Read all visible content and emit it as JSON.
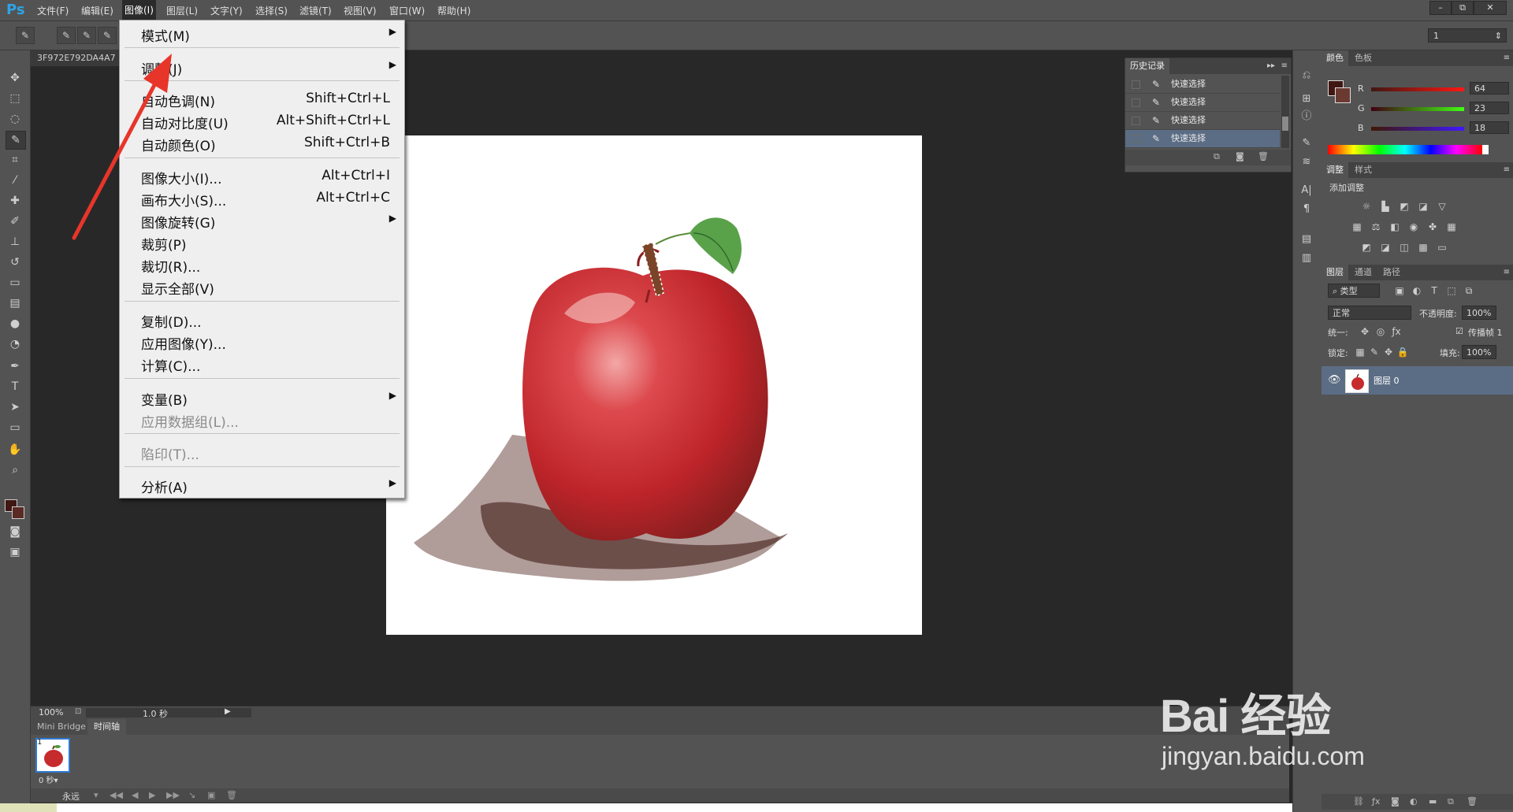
{
  "app": {
    "logo": "Ps"
  },
  "menubar": {
    "items": [
      "文件(F)",
      "编辑(E)",
      "图像(I)",
      "图层(L)",
      "文字(Y)",
      "选择(S)",
      "滤镜(T)",
      "视图(V)",
      "窗口(W)",
      "帮助(H)"
    ],
    "active": "图像(I)"
  },
  "window_buttons": [
    "–",
    "⧉",
    "✕"
  ],
  "options": {
    "select_value": "1"
  },
  "document": {
    "tab_title": "3F972E792DA4A7",
    "zoom": "100%",
    "frame_time": "1.0 秒"
  },
  "image_menu": {
    "items": [
      {
        "label": "模式(M)",
        "shortcut": "",
        "submenu": true,
        "disabled": false
      },
      {
        "label": "调整(J)",
        "shortcut": "",
        "submenu": true,
        "disabled": false
      },
      {
        "label": "自动色调(N)",
        "shortcut": "Shift+Ctrl+L",
        "submenu": false,
        "disabled": false
      },
      {
        "label": "自动对比度(U)",
        "shortcut": "Alt+Shift+Ctrl+L",
        "submenu": false,
        "disabled": false
      },
      {
        "label": "自动颜色(O)",
        "shortcut": "Shift+Ctrl+B",
        "submenu": false,
        "disabled": false
      },
      {
        "label": "图像大小(I)...",
        "shortcut": "Alt+Ctrl+I",
        "submenu": false,
        "disabled": false
      },
      {
        "label": "画布大小(S)...",
        "shortcut": "Alt+Ctrl+C",
        "submenu": false,
        "disabled": false
      },
      {
        "label": "图像旋转(G)",
        "shortcut": "",
        "submenu": true,
        "disabled": false
      },
      {
        "label": "裁剪(P)",
        "shortcut": "",
        "submenu": false,
        "disabled": false
      },
      {
        "label": "裁切(R)...",
        "shortcut": "",
        "submenu": false,
        "disabled": false
      },
      {
        "label": "显示全部(V)",
        "shortcut": "",
        "submenu": false,
        "disabled": false
      },
      {
        "label": "复制(D)...",
        "shortcut": "",
        "submenu": false,
        "disabled": false
      },
      {
        "label": "应用图像(Y)...",
        "shortcut": "",
        "submenu": false,
        "disabled": false
      },
      {
        "label": "计算(C)...",
        "shortcut": "",
        "submenu": false,
        "disabled": false
      },
      {
        "label": "变量(B)",
        "shortcut": "",
        "submenu": true,
        "disabled": false
      },
      {
        "label": "应用数据组(L)...",
        "shortcut": "",
        "submenu": false,
        "disabled": true
      },
      {
        "label": "陷印(T)...",
        "shortcut": "",
        "submenu": false,
        "disabled": true
      },
      {
        "label": "分析(A)",
        "shortcut": "",
        "submenu": true,
        "disabled": false
      }
    ]
  },
  "history": {
    "tab": "历史记录",
    "items": [
      "快速选择",
      "快速选择",
      "快速选择",
      "快速选择"
    ],
    "selected_index": 3
  },
  "color_panel": {
    "tabs": [
      "颜色",
      "色板"
    ],
    "channels": [
      {
        "name": "R",
        "value": "64"
      },
      {
        "name": "G",
        "value": "23"
      },
      {
        "name": "B",
        "value": "18"
      }
    ],
    "foreground": "#401712"
  },
  "adjustments_panel": {
    "tabs": [
      "调整",
      "样式"
    ],
    "add_label": "添加调整"
  },
  "layers_panel": {
    "tabs": [
      "图层",
      "通道",
      "路径"
    ],
    "filter": "类型",
    "blend_mode": "正常",
    "opacity_label": "不透明度:",
    "opacity": "100%",
    "unify_label": "统一:",
    "propagate_label": "传播帧 1",
    "lock_label": "锁定:",
    "fill_label": "填充:",
    "fill": "100%",
    "layer_name": "图层 0"
  },
  "bottom_tabs": [
    "Mini Bridge",
    "时间轴"
  ],
  "timeline": {
    "frame_number": "1",
    "frame_delay": "0 秒▾",
    "loop": "永远"
  },
  "watermark": {
    "logo": "Bai 经验",
    "url": "jingyan.baidu.com"
  },
  "colors": {
    "accent": "#2fa3e6",
    "selected_row": "#5b6d84",
    "arrow": "#e8352a"
  }
}
